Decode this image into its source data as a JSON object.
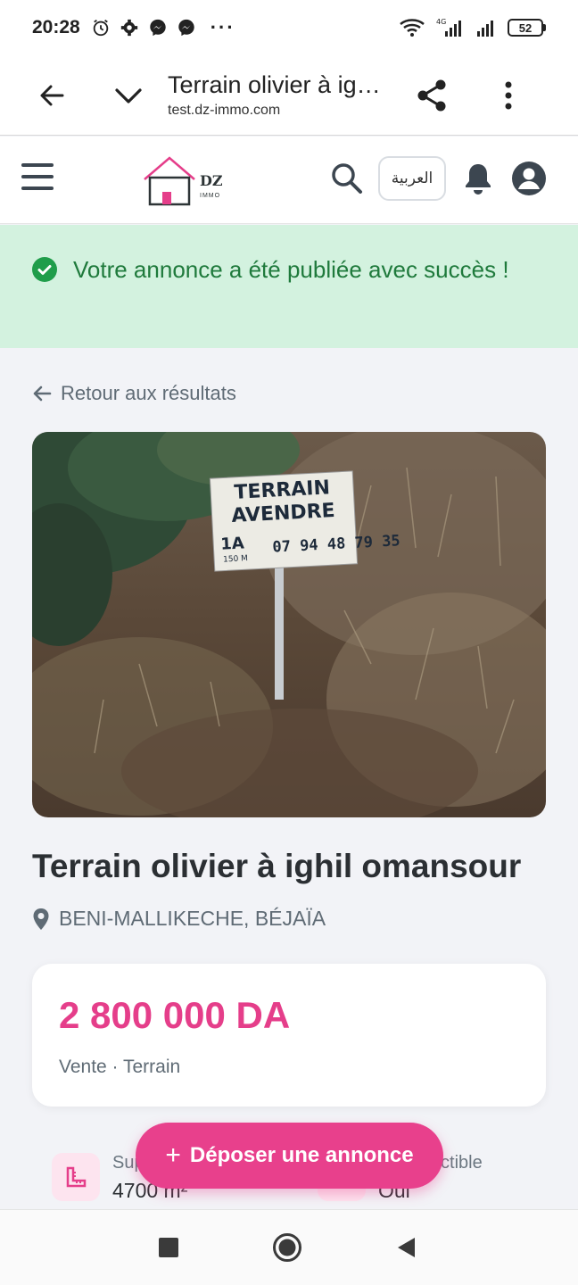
{
  "status_bar": {
    "time": "20:28",
    "signal_label": "4G",
    "battery": "52"
  },
  "browser": {
    "page_title": "Terrain olivier à ighil omansour",
    "url": "test.dz-immo.com"
  },
  "site_header": {
    "logo_text": "DZ",
    "logo_subtext": "IMMO",
    "language_button": "العربية"
  },
  "alert": {
    "message": "Votre annonce a été publiée avec succès !",
    "color": "#1f7a3c",
    "background": "#d3f2df"
  },
  "back_link": "Retour aux résultats",
  "photo": {
    "sign_line1": "TERRAIN",
    "sign_line2": "AVENDRE",
    "sign_phone": "07 94 48 79 35",
    "sign_note": "1A",
    "sign_note2": "150 M"
  },
  "listing": {
    "title": "Terrain olivier à ighil omansour",
    "location": "BENI-MALLIKECHE, BÉJAÏA",
    "price": "2 800 000 DA",
    "meta": "Vente · Terrain",
    "accent_color": "#e53e8a"
  },
  "features": [
    {
      "label": "Superficie",
      "value": "4700 m²",
      "icon": "ruler-icon"
    },
    {
      "label": "Constructible",
      "value": "Oui",
      "icon": "building-icon"
    }
  ],
  "fab": {
    "label": "Déposer une annonce",
    "color": "#e8408c"
  }
}
